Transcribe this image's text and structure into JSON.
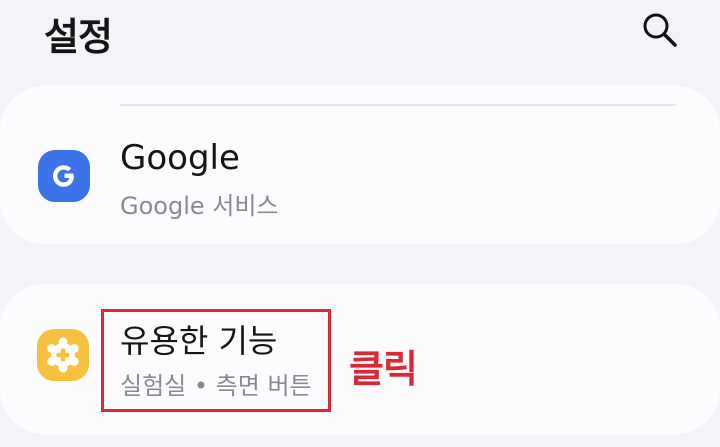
{
  "header": {
    "title": "설정",
    "search_icon": "search-icon"
  },
  "settings": {
    "items": [
      {
        "title": "Google",
        "subtitle": "Google 서비스",
        "icon": "google-g-icon",
        "icon_color": "#3d73e8"
      },
      {
        "title": "유용한 기능",
        "subtitle": "실험실 • 측면 버튼",
        "icon": "gear-plus-icon",
        "icon_color": "#f7c13f"
      }
    ]
  },
  "annotation": {
    "label": "클릭",
    "color": "#d72a35"
  }
}
